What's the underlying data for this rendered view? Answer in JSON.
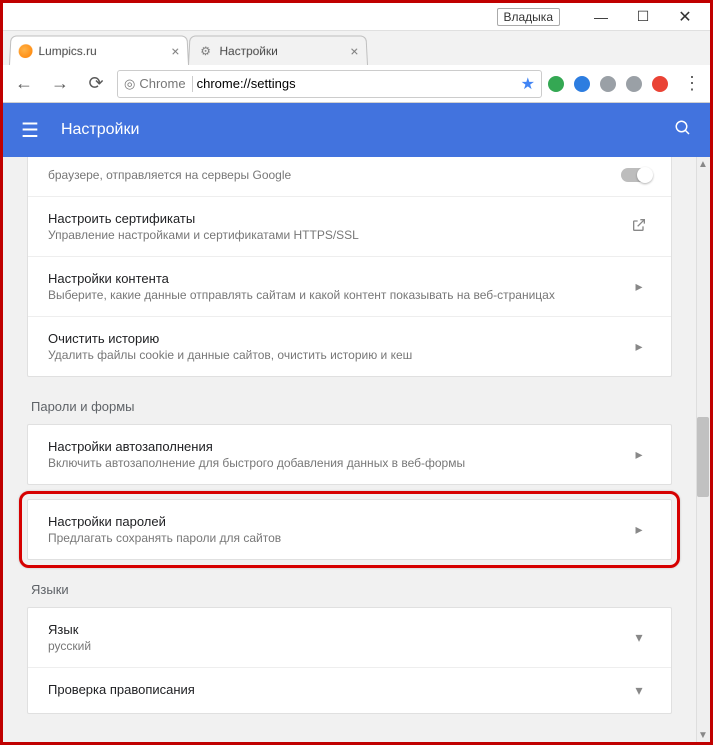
{
  "window": {
    "user": "Владыка"
  },
  "tabs": [
    {
      "label": "Lumpics.ru"
    },
    {
      "label": "Настройки"
    }
  ],
  "omnibox": {
    "badge": "Chrome",
    "url": "chrome://settings"
  },
  "header": {
    "title": "Настройки"
  },
  "privacy_rows": {
    "r0_sub": "браузере, отправляется на серверы Google",
    "r1_title": "Настроить сертификаты",
    "r1_sub": "Управление настройками и сертификатами HTTPS/SSL",
    "r2_title": "Настройки контента",
    "r2_sub": "Выберите, какие данные отправлять сайтам и какой контент показывать на веб-страницах",
    "r3_title": "Очистить историю",
    "r3_sub": "Удалить файлы cookie и данные сайтов, очистить историю и кеш"
  },
  "section_passwords": "Пароли и формы",
  "passwords_rows": {
    "autofill_title": "Настройки автозаполнения",
    "autofill_sub": "Включить автозаполнение для быстрого добавления данных в веб-формы",
    "passwords_title": "Настройки паролей",
    "passwords_sub": "Предлагать сохранять пароли для сайтов"
  },
  "section_languages": "Языки",
  "lang_rows": {
    "lang_title": "Язык",
    "lang_sub": "русский",
    "spell_title": "Проверка правописания"
  }
}
